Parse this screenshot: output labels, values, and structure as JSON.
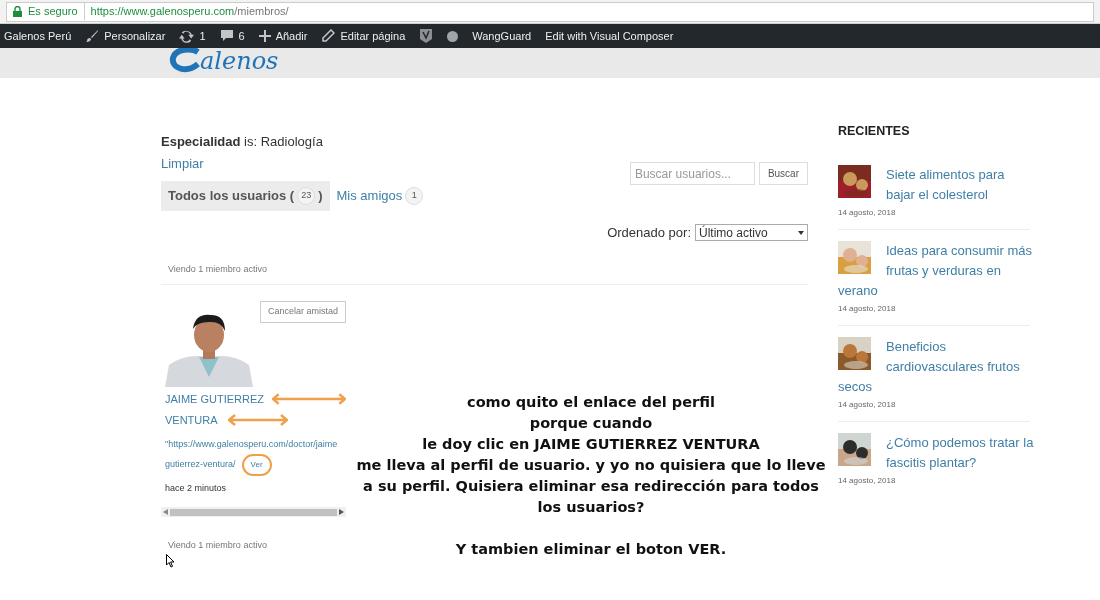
{
  "browser": {
    "security": "Es seguro",
    "url_host": "https://www.galenosperu.com",
    "url_path": "/miembros/"
  },
  "admin_bar": [
    {
      "kind": "text",
      "label": "Galenos Perú"
    },
    {
      "kind": "brush",
      "label": "Personalizar"
    },
    {
      "kind": "updates",
      "label": "1"
    },
    {
      "kind": "comments",
      "label": "6"
    },
    {
      "kind": "plus",
      "label": "Añadir"
    },
    {
      "kind": "pencil",
      "label": "Editar página"
    },
    {
      "kind": "shield"
    },
    {
      "kind": "dot"
    },
    {
      "kind": "text",
      "label": "WangGuard"
    },
    {
      "kind": "text",
      "label": "Edit with Visual Composer"
    }
  ],
  "logo": "alenos",
  "filter": {
    "field": "Especialidad",
    "rest": " is: Radiología",
    "clear": "Limpiar"
  },
  "search": {
    "placeholder": "Buscar usuarios...",
    "button": "Buscar"
  },
  "tabs": [
    {
      "label": "Todos los usuarios (",
      "count": "23",
      "close": ")",
      "selected": true
    },
    {
      "label": "Mis amigos",
      "count": "1",
      "selected": false
    }
  ],
  "order": {
    "label": "Ordenado por:",
    "value": "Último activo"
  },
  "viewing_top": "Viendo 1 miembro activo",
  "member": {
    "action": "Cancelar amistad",
    "name_line1": "JAIME GUTIERREZ",
    "name_line2": "VENTURA",
    "link_line1": "\"https://www.galenosperu.com/doctor/jaime",
    "link_line2": "gutierrez-ventura/",
    "view": "Ver",
    "active": "hace 2 minutos"
  },
  "viewing_bottom": "Viendo 1 miembro activo",
  "annotation": {
    "lines": [
      "como quito el enlace del perfil",
      "porque cuando",
      "le doy clic en JAIME GUTIERREZ VENTURA",
      "me lleva al perfil de usuario. y yo no quisiera que lo lleve",
      "a su perfil. Quisiera eliminar esa redirección para todos",
      "los usuarios?"
    ],
    "footer": "Y tambien eliminar el boton VER."
  },
  "sidebar": {
    "title": "RECIENTES",
    "posts": [
      {
        "title_line1": "Siete alimentos para",
        "title_line2": "bajar el colesterol",
        "date": "14 agosto, 2018"
      },
      {
        "title_line1": "Ideas para consumir más",
        "title_line2": "frutas y verduras en",
        "title_tail": "verano",
        "date": "14 agosto, 2018"
      },
      {
        "title_line1": "Beneficios",
        "title_line2": "cardiovasculares frutos",
        "title_tail": "secos",
        "date": "14 agosto, 2018"
      },
      {
        "title_line1": "¿Cómo podemos tratar la",
        "title_line2": "fascitis plantar?",
        "date": "14 agosto, 2018"
      }
    ]
  }
}
